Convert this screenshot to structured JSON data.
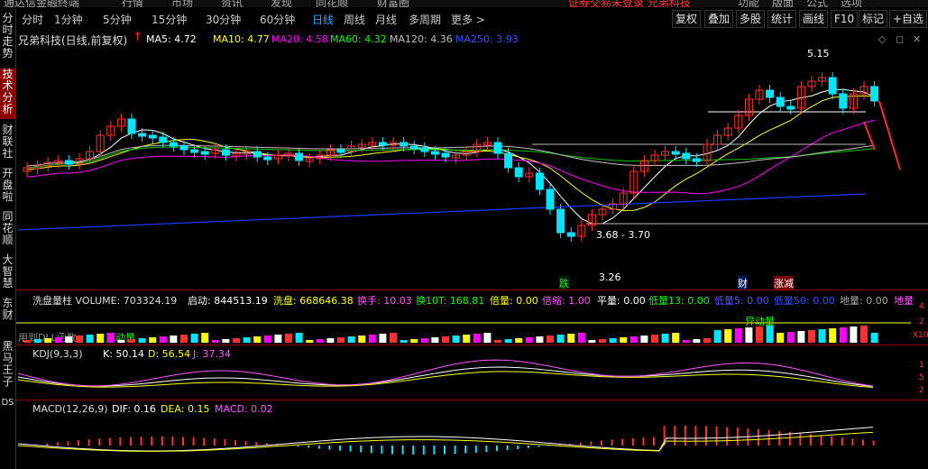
{
  "app": {
    "title": "通达信金融终端",
    "menu": [
      "行情",
      "市场",
      "资讯",
      "发现",
      "同花顺",
      "财富圈"
    ],
    "right_menu": [
      "功能",
      "版面",
      "公式",
      "选项"
    ],
    "banner": "证券交易未登录 兄弟科技"
  },
  "toolbar": {
    "periods": [
      "分时",
      "1分钟",
      "5分钟",
      "15分钟",
      "30分钟",
      "60分钟",
      "日线",
      "周线",
      "月线",
      "多周期",
      "更多 >"
    ],
    "active_period": "日线",
    "buttons": [
      "复权",
      "叠加",
      "多股",
      "统计",
      "画线",
      "F10",
      "标记",
      "+自选"
    ]
  },
  "leftnav": [
    "分时走势",
    "技术分析",
    "财联社",
    "开盘啦",
    "同花顺",
    "大智慧",
    "东财",
    "黑马王子",
    "DS"
  ],
  "main": {
    "stock_label": "兄弟科技(日线,前复权)",
    "ma": [
      {
        "label": "MA5: 4.72",
        "color": "#ffffff"
      },
      {
        "label": "MA10: 4.77",
        "color": "#ffff00"
      },
      {
        "label": "MA20: 4.58",
        "color": "#ff00ff"
      },
      {
        "label": "MA60: 4.32",
        "color": "#00ff00"
      },
      {
        "label": "MA120: 4.36",
        "color": "#c0c0c0"
      },
      {
        "label": "MA250: 3.93",
        "color": "#3050ff"
      }
    ],
    "high_label": "5.15",
    "low_label": "3.26",
    "range_label": "3.68 - 3.70",
    "events": {
      "fall": "跌",
      "cai": "财",
      "zhang": "涨减"
    },
    "header_icons": [
      "◇",
      "◻",
      "✕"
    ]
  },
  "volume": {
    "title": "洗盘量柱 VOLUME: 703324.19",
    "items": [
      {
        "label": "启动: 844513.19",
        "color": "#ffffff"
      },
      {
        "label": "洗盘: 668646.38",
        "color": "#ffff00"
      },
      {
        "label": "换手: 10.03",
        "color": "#ff55ff"
      },
      {
        "label": "换10T: 168.81",
        "color": "#00ff00"
      },
      {
        "label": "倍量: 0.00",
        "color": "#ffff00"
      },
      {
        "label": "倍缩: 1.00",
        "color": "#ff55ff"
      },
      {
        "label": "平量: 0.00",
        "color": "#ffffff"
      },
      {
        "label": "低量13: 0.00",
        "color": "#00ff00"
      },
      {
        "label": "低量5: 0.00",
        "color": "#5555ff"
      },
      {
        "label": "低量50: 0.00",
        "color": "#3050ff"
      },
      {
        "label": "地量: 0.00",
        "color": "#aaaaaa"
      },
      {
        "label": "地量",
        "color": "#ff55ff"
      }
    ],
    "notes": [
      "用到DLL函数",
      "异动量",
      "异动量"
    ],
    "axis": [
      "4",
      "2",
      "X10"
    ]
  },
  "kdj": {
    "title": "KDJ(9,3,3)",
    "items": [
      {
        "label": "K: 50.14",
        "color": "#ffffff"
      },
      {
        "label": "D: 56.54",
        "color": "#ffff00"
      },
      {
        "label": "J: 37.34",
        "color": "#ff55ff"
      }
    ],
    "axis": [
      "1",
      "5",
      "2"
    ]
  },
  "macd": {
    "title": "MACD(12,26,9)",
    "items": [
      {
        "label": "DIF: 0.16",
        "color": "#ffffff"
      },
      {
        "label": "DEA: 0.15",
        "color": "#ffff00"
      },
      {
        "label": "MACD: 0.02",
        "color": "#ff55ff"
      }
    ]
  },
  "colors": {
    "up": "#ff3030",
    "down": "#00e5ff",
    "ma5": "#ffffff",
    "ma10": "#ffff00",
    "ma20": "#ff00ff",
    "ma60": "#00c800",
    "ma120": "#c0c0c0",
    "ma250": "#1a3cff"
  }
}
